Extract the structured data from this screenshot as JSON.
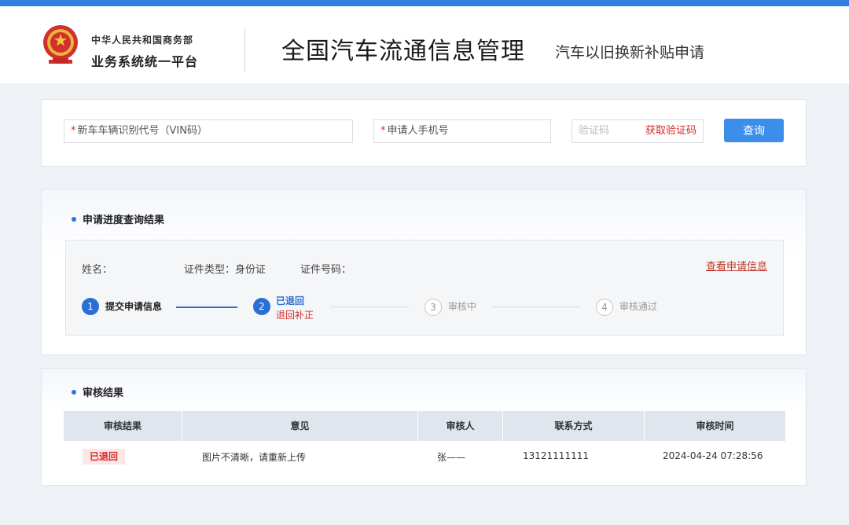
{
  "header": {
    "org_line1": "中华人民共和国商务部",
    "org_line2": "业务系统统一平台",
    "title": "全国汽车流通信息管理",
    "subtitle": "汽车以旧换新补贴申请"
  },
  "search": {
    "vin_placeholder": "新车车辆识别代号（VIN码）",
    "phone_placeholder": "申请人手机号",
    "code_placeholder": "验证码",
    "get_code": "获取验证码",
    "query_button": "查询",
    "required_mark": "*"
  },
  "progress": {
    "section_title": "申请进度查询结果",
    "name_label": "姓名：",
    "id_type_label": "证件类型：身份证",
    "id_number_label": "证件号码：",
    "view_link": "查看申请信息",
    "steps": [
      {
        "num": "1",
        "label": "提交申请信息"
      },
      {
        "num": "2",
        "label": "已退回",
        "sublabel": "退回补正"
      },
      {
        "num": "3",
        "label": "审核中"
      },
      {
        "num": "4",
        "label": "审核通过"
      }
    ]
  },
  "review": {
    "section_title": "审核结果",
    "columns": [
      "审核结果",
      "意见",
      "审核人",
      "联系方式",
      "审核时间"
    ],
    "row": {
      "status": "已退回",
      "opinion": "图片不清晰，请重新上传",
      "reviewer": "张——",
      "contact": "13121111111",
      "time": "2024-04-24 07:28:56"
    }
  },
  "colors": {
    "accent": "#2f7fe0",
    "button": "#3b8eea",
    "step_active": "#2a6fd6",
    "warning_red": "#d22d2d"
  }
}
